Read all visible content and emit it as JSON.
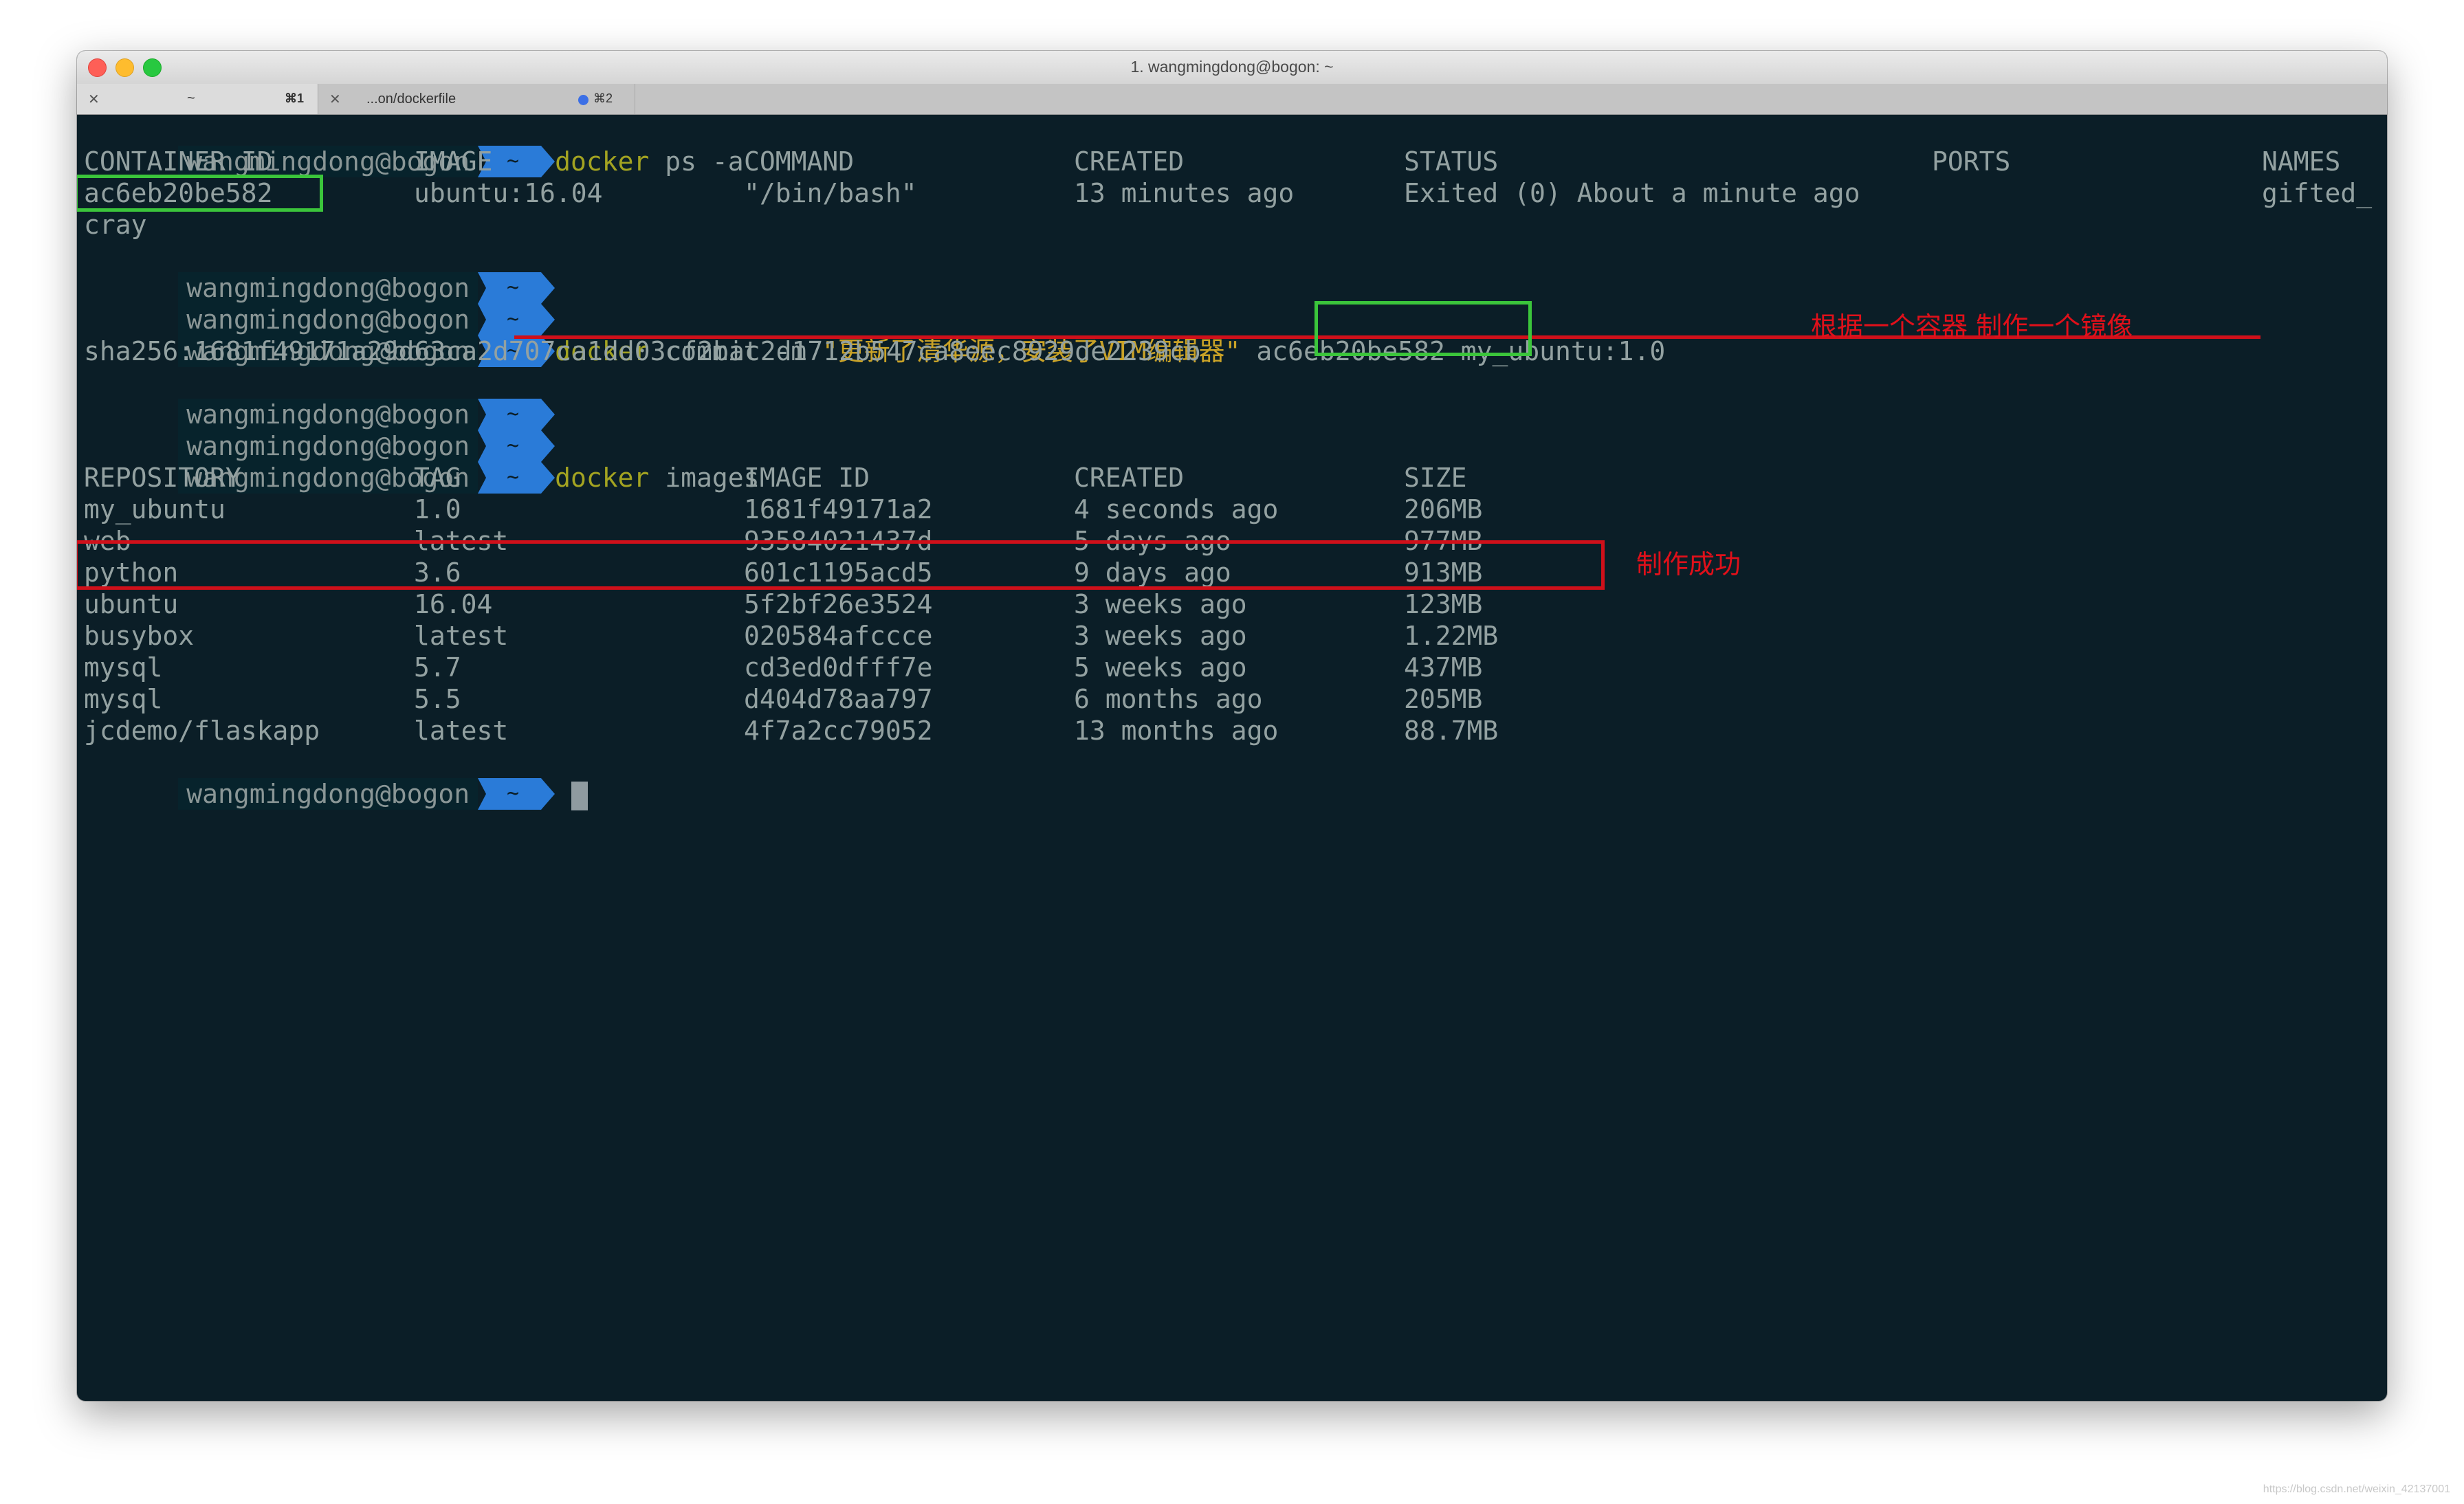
{
  "window": {
    "title": "1. wangmingdong@bogon: ~"
  },
  "tabs": [
    {
      "label": "~",
      "shortcut": "⌘1",
      "close": "✕"
    },
    {
      "label": "...on/dockerfile",
      "shortcut": "⌘2",
      "close": "✕"
    }
  ],
  "prompt": {
    "user": "wangmingdong@bogon",
    "dir": "~"
  },
  "commands": {
    "ps": "ps -a",
    "docker": "docker",
    "commit_pre": "commit -m ",
    "commit_msg": "\"更新了清华源，安装了VIM编辑器\"",
    "commit_id": "ac6eb20be582",
    "commit_post": "my_ubuntu:1.0",
    "images": "images"
  },
  "ps_table": {
    "headers": [
      "CONTAINER ID",
      "IMAGE",
      "COMMAND",
      "CREATED",
      "STATUS",
      "PORTS",
      "NAMES"
    ],
    "row": [
      "ac6eb20be582",
      "ubuntu:16.04",
      "\"/bin/bash\"",
      "13 minutes ago",
      "Exited (0) About a minute ago",
      "",
      "gifted_"
    ],
    "wrap": "cray"
  },
  "sha": "sha256:1681f49171a29d63ca2d707ca1dd03cf2bac2d1712b547ca8eec8929de2239cb",
  "images_table": {
    "headers": [
      "REPOSITORY",
      "TAG",
      "IMAGE ID",
      "CREATED",
      "SIZE"
    ],
    "rows": [
      [
        "my_ubuntu",
        "1.0",
        "1681f49171a2",
        "4 seconds ago",
        "206MB"
      ],
      [
        "web",
        "latest",
        "93584021437d",
        "5 days ago",
        "977MB"
      ],
      [
        "python",
        "3.6",
        "601c1195acd5",
        "9 days ago",
        "913MB"
      ],
      [
        "ubuntu",
        "16.04",
        "5f2bf26e3524",
        "3 weeks ago",
        "123MB"
      ],
      [
        "busybox",
        "latest",
        "020584afccce",
        "3 weeks ago",
        "1.22MB"
      ],
      [
        "mysql",
        "5.7",
        "cd3ed0dfff7e",
        "5 weeks ago",
        "437MB"
      ],
      [
        "mysql",
        "5.5",
        "d404d78aa797",
        "6 months ago",
        "205MB"
      ],
      [
        "jcdemo/flaskapp",
        "latest",
        "4f7a2cc79052",
        "13 months ago",
        "88.7MB"
      ]
    ]
  },
  "annotations": {
    "commit_note": "根据一个容器 制作一个镜像",
    "success_note": "制作成功"
  },
  "colors": {
    "terminal_bg": "#0b1e27",
    "prompt_arrow": "#2a7bd8",
    "keyword": "#a3a321",
    "highlight_green": "#3bc53b",
    "highlight_red": "#d0101a"
  },
  "watermark": "https://blog.csdn.net/weixin_42137001"
}
